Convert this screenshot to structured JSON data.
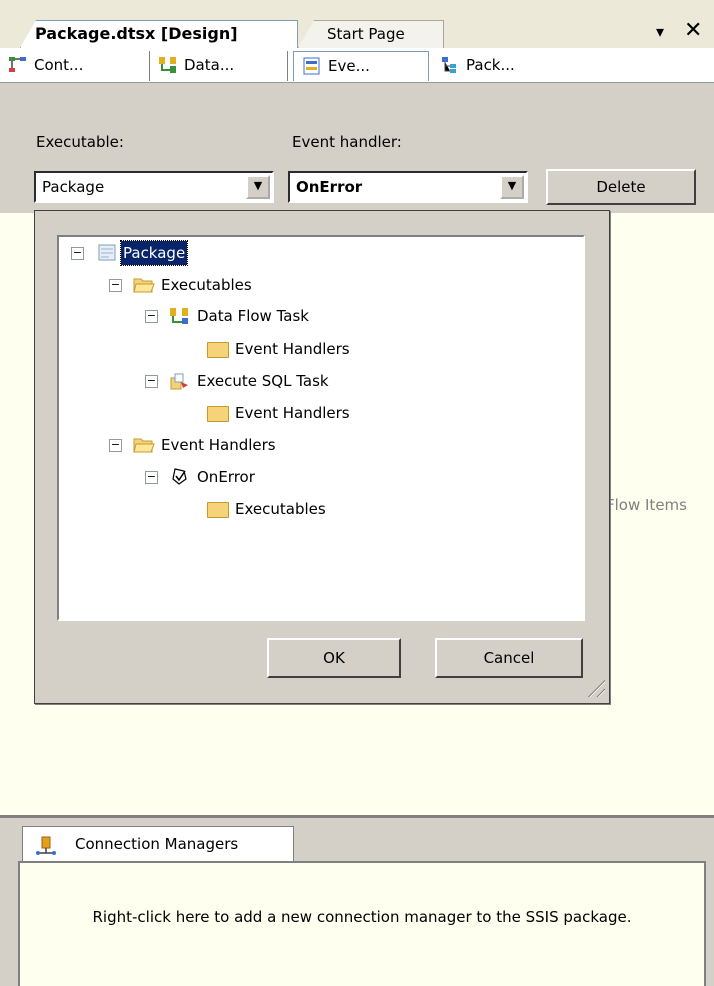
{
  "document_tabs": {
    "active": "Package.dtsx [Design]",
    "inactive": "Start Page",
    "menu_arrow": "▾",
    "close": "✕"
  },
  "designer_tabs": [
    {
      "label": "Cont...",
      "icon": "control-flow-icon"
    },
    {
      "label": "Data...",
      "icon": "data-flow-icon"
    },
    {
      "label": "Eve...",
      "icon": "event-handlers-icon"
    },
    {
      "label": "Pack...",
      "icon": "package-explorer-icon"
    }
  ],
  "toolbar": {
    "executable_label": "Executable:",
    "executable_value": "Package",
    "event_handler_label": "Event handler:",
    "event_handler_value": "OnError",
    "delete_label": "Delete"
  },
  "design_surface": {
    "hint_fragment": "Flow Items"
  },
  "tree": {
    "package": "Package",
    "executables": "Executables",
    "data_flow_task": "Data Flow Task",
    "dft_event_handlers": "Event Handlers",
    "execute_sql_task": "Execute SQL Task",
    "sql_event_handlers": "Event Handlers",
    "event_handlers": "Event Handlers",
    "on_error": "OnError",
    "on_error_executables": "Executables",
    "expander": "−"
  },
  "dialog": {
    "ok_label": "OK",
    "cancel_label": "Cancel"
  },
  "connection_managers": {
    "tab_label": "Connection Managers",
    "hint": "Right-click here to add a new connection manager to the SSIS package."
  },
  "colors": {
    "selection": "#0a246a",
    "surface": "#fffff0",
    "chrome": "#d4d0c8"
  }
}
